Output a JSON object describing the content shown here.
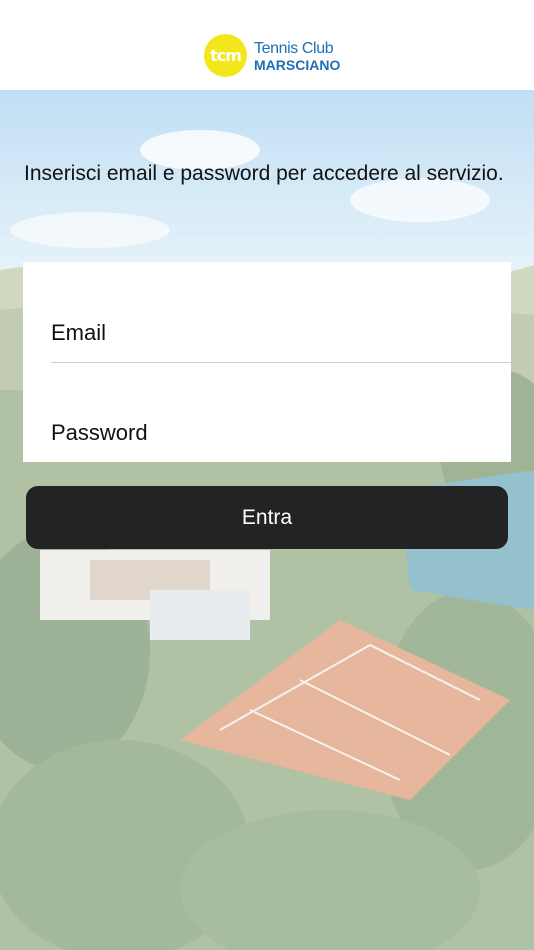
{
  "header": {
    "logo": {
      "mark": "tcm",
      "line1": "Tennis Club",
      "line2": "MARSCIANO"
    }
  },
  "intro_text": "Inserisci email e password per accedere al servizio.",
  "form": {
    "email_placeholder": "Email",
    "password_placeholder": "Password",
    "submit_label": "Entra"
  },
  "colors": {
    "logo_yellow": "#f4e61c",
    "logo_blue": "#1e6fb5",
    "button_dark": "#232326"
  },
  "background": {
    "icon": "tennis-club-aerial-photo"
  }
}
